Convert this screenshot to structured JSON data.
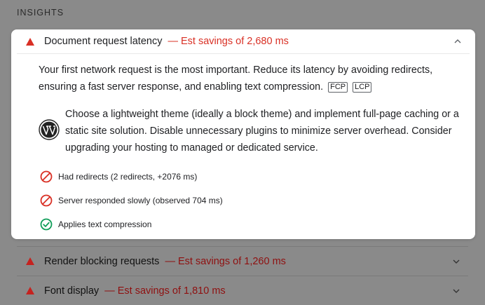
{
  "section": {
    "title": "INSIGHTS"
  },
  "expanded": {
    "title": "Document request latency",
    "savings": "— Est savings of 2,680 ms",
    "description": "Your first network request is the most important. Reduce its latency by avoiding redirects, ensuring a fast server response, and enabling text compression.",
    "badges": [
      "FCP",
      "LCP"
    ],
    "stack_tip": "Choose a lightweight theme (ideally a block theme) and implement full-page caching or a static site solution. Disable unnecessary plugins to minimize server overhead. Consider upgrading your hosting to managed or dedicated service.",
    "checks": [
      {
        "label": "Had redirects (2 redirects, +2076 ms)",
        "status": "fail"
      },
      {
        "label": "Server responded slowly (observed 704 ms)",
        "status": "fail"
      },
      {
        "label": "Applies text compression",
        "status": "pass"
      }
    ]
  },
  "collapsed": [
    {
      "title": "Render blocking requests",
      "savings": "— Est savings of 1,260 ms"
    },
    {
      "title": "Font display",
      "savings": "— Est savings of 1,810 ms"
    }
  ],
  "colors": {
    "fail": "#d93025",
    "pass": "#0f9d58",
    "overlay": "#8a8a8a"
  }
}
